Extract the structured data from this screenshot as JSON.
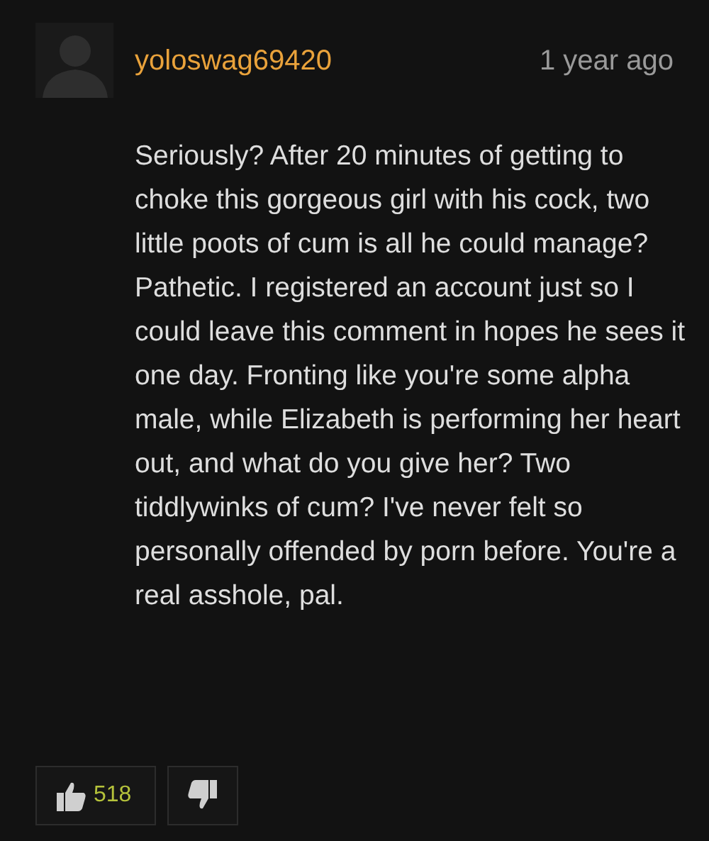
{
  "comment": {
    "username": "yoloswag69420",
    "time": "1 year ago",
    "body": "Seriously? After 20 minutes of getting to choke this gorgeous girl with his cock, two little poots of cum is all he could manage? Pathetic. I registered an account just so I could leave this comment in hopes he sees it one day. Fronting like you're some alpha male, while Elizabeth is performing her heart out, and what do you give her? Two tiddlywinks of cum? I've never felt so personally offended by porn before. You're a real asshole, pal.",
    "likes": "518"
  }
}
